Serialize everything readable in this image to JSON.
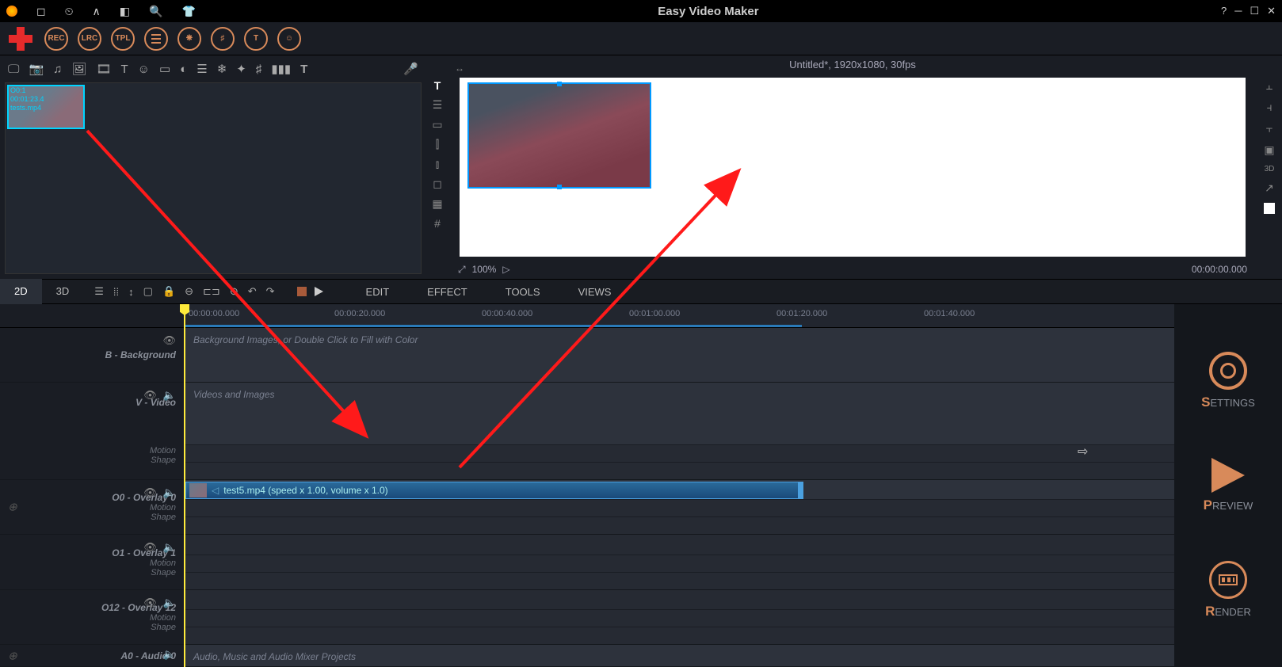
{
  "app": {
    "title": "Easy Video Maker"
  },
  "project": {
    "title": "Untitled*, 1920x1080, 30fps"
  },
  "toolbar1": {
    "rec": "REC",
    "lrc": "LRC",
    "tpl": "TPL"
  },
  "media": {
    "thumb_index": "O0:1",
    "thumb_duration": "00:01:23.4",
    "thumb_name": "tests.mp4"
  },
  "preview": {
    "zoom": "100%",
    "time": "00:00:00.000"
  },
  "tabs": {
    "t2d": "2D",
    "t3d": "3D"
  },
  "menus": {
    "edit": "EDIT",
    "effect": "EFFECT",
    "tools": "TOOLS",
    "views": "VIEWS"
  },
  "ruler": {
    "t0": "00:00:00.000",
    "t1": "00:00:20.000",
    "t2": "00:00:40.000",
    "t3": "00:01:00.000",
    "t4": "00:01:20.000",
    "t5": "00:01:40.000"
  },
  "tracks": {
    "bg": {
      "name": "B - Background",
      "hint": "Background Images, or Double Click to Fill with Color"
    },
    "video": {
      "name": "V - Video",
      "hint": "Videos and Images",
      "motion": "Motion",
      "shape": "Shape"
    },
    "o0": {
      "name": "O0 - Overlay 0",
      "motion": "Motion",
      "shape": "Shape",
      "clip_text": "test5.mp4  (speed x 1.00, volume x 1.0)"
    },
    "o1": {
      "name": "O1 - Overlay 1",
      "motion": "Motion",
      "shape": "Shape"
    },
    "o12": {
      "name": "O12 - Overlay 12",
      "motion": "Motion",
      "shape": "Shape"
    },
    "a0": {
      "name": "A0 - Audio 0",
      "hint": "Audio, Music and Audio Mixer Projects"
    }
  },
  "right": {
    "settings_b": "S",
    "settings": "ETTINGS",
    "preview_b": "P",
    "preview": "REVIEW",
    "render_b": "R",
    "render": "ENDER"
  }
}
